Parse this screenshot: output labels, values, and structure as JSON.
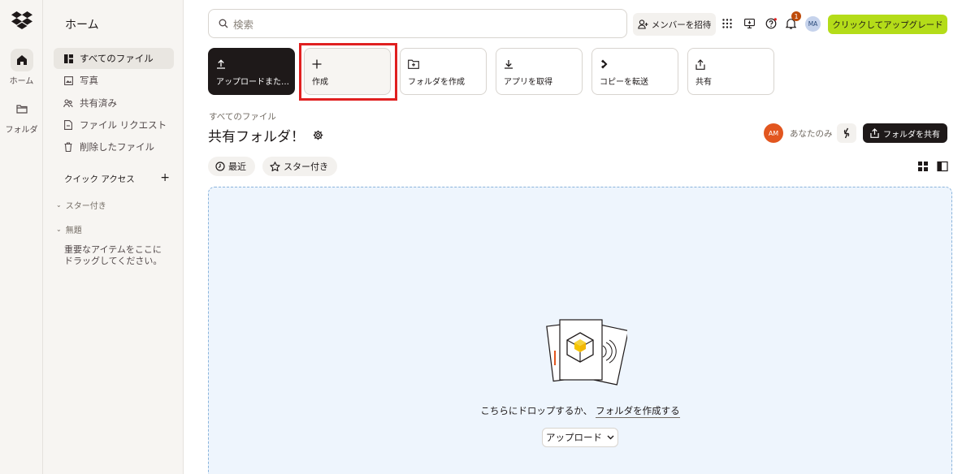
{
  "rail": {
    "items": [
      {
        "label": "ホーム",
        "icon": "home-icon"
      },
      {
        "label": "フォルダ",
        "icon": "folder-icon"
      }
    ]
  },
  "nav": {
    "title": "ホーム",
    "items": [
      {
        "label": "すべてのファイル",
        "icon": "files-icon"
      },
      {
        "label": "写真",
        "icon": "photo-icon"
      },
      {
        "label": "共有済み",
        "icon": "shared-icon"
      },
      {
        "label": "ファイル リクエスト",
        "icon": "file-request-icon"
      },
      {
        "label": "削除したファイル",
        "icon": "trash-icon"
      }
    ],
    "quick_access": "クイック アクセス",
    "sections": [
      "スター付き",
      "無題"
    ],
    "hint": "重要なアイテムをここにドラッグしてください。"
  },
  "topbar": {
    "search_placeholder": "検索",
    "invite": "メンバーを招待",
    "notification_count": "1",
    "avatar": "MA",
    "upgrade": "クリックしてアップグレード"
  },
  "tiles": [
    {
      "label": "アップロードまたはドロップ",
      "icon": "upload-icon"
    },
    {
      "label": "作成",
      "icon": "plus-icon"
    },
    {
      "label": "フォルダを作成",
      "icon": "new-folder-icon"
    },
    {
      "label": "アプリを取得",
      "icon": "download-icon"
    },
    {
      "label": "コピーを転送",
      "icon": "transfer-icon"
    },
    {
      "label": "共有",
      "icon": "share-icon"
    }
  ],
  "header": {
    "breadcrumb": "すべてのファイル",
    "title": "共有フォルダ！",
    "owner_avatar": "AM",
    "visibility": "あなたのみ",
    "share_folder": "フォルダを共有"
  },
  "filters": {
    "recent": "最近",
    "starred": "スター付き"
  },
  "dropzone": {
    "text": "こちらにドロップするか、",
    "link": "フォルダを作成する",
    "upload": "アップロード"
  },
  "colors": {
    "accent_green": "#b4dc19",
    "highlight_red": "#e02020",
    "owner_orange": "#e2561f",
    "drop_bg": "#eef5fd"
  }
}
